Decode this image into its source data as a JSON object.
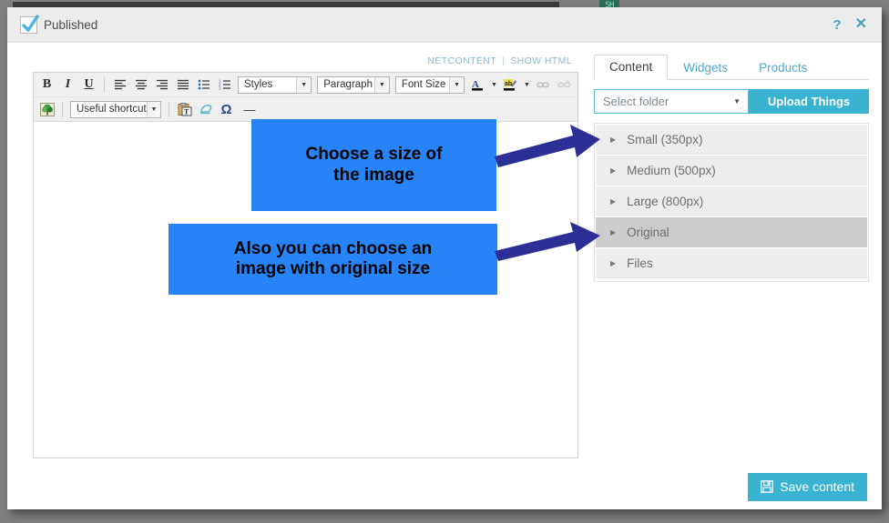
{
  "window": {
    "published_label": "Published",
    "help_icon": "question-mark-icon",
    "close_icon": "close-x-icon",
    "accent_color": "#39b3d0",
    "checkbox_checked": true
  },
  "background": {
    "tag_text": "SH"
  },
  "editor": {
    "links": {
      "netcontent": "NETCONTENT",
      "separator": "|",
      "show_html": "SHOW HTML"
    },
    "toolbar_row1": [
      {
        "name": "bold-button",
        "label": "B",
        "kind": "text-b"
      },
      {
        "name": "italic-button",
        "label": "I",
        "kind": "text-i"
      },
      {
        "name": "underline-button",
        "label": "U",
        "kind": "text-u"
      },
      {
        "name": "separator",
        "label": "",
        "kind": "sep"
      },
      {
        "name": "align-left-button",
        "label": "",
        "kind": "align-left"
      },
      {
        "name": "align-center-button",
        "label": "",
        "kind": "align-center"
      },
      {
        "name": "align-right-button",
        "label": "",
        "kind": "align-right"
      },
      {
        "name": "align-justify-button",
        "label": "",
        "kind": "align-justify"
      },
      {
        "name": "bulleted-list-button",
        "label": "",
        "kind": "ul"
      },
      {
        "name": "numbered-list-button",
        "label": "",
        "kind": "ol"
      }
    ],
    "selects_row1": [
      {
        "name": "styles-select",
        "value": "Styles"
      },
      {
        "name": "paragraph-select",
        "value": "Paragraph"
      },
      {
        "name": "font-size-select",
        "value": "Font Size"
      }
    ],
    "toolbar_row1_end": [
      {
        "name": "text-color-button",
        "label": "A"
      },
      {
        "name": "text-color-dropdown",
        "label": "▾"
      },
      {
        "name": "highlight-color-button",
        "label": "ab"
      },
      {
        "name": "highlight-color-dropdown",
        "label": "▾"
      },
      {
        "name": "insert-link-button",
        "label": ""
      },
      {
        "name": "unlink-button",
        "label": ""
      }
    ],
    "toolbar_row2": {
      "image-tree-button": "tree-image-icon",
      "shortcuts_select": "Useful shortcuts",
      "paste-text-button": "paste-as-text-icon",
      "erase-format-button": "eraser-icon",
      "special-char-button": "Ω",
      "horizontal-rule-button": "—"
    }
  },
  "panel": {
    "tabs": [
      {
        "label": "Content",
        "active": true
      },
      {
        "label": "Widgets",
        "active": false
      },
      {
        "label": "Products",
        "active": false
      }
    ],
    "folder_select_value": "Select folder",
    "upload_button": "Upload Things",
    "accordion_items": [
      {
        "label": "Small (350px)",
        "selected": false
      },
      {
        "label": "Medium (500px)",
        "selected": false
      },
      {
        "label": "Large (800px)",
        "selected": false
      },
      {
        "label": "Original",
        "selected": true
      },
      {
        "label": "Files",
        "selected": false
      }
    ]
  },
  "footer": {
    "save_label": "Save content",
    "save_icon": "floppy-disk-icon"
  },
  "annotations": [
    {
      "id": "anno1",
      "line1": "Choose a size of",
      "line2": "the image",
      "color": "#2684f7",
      "arrow_color": "#2c2f96",
      "points_to": "Small (350px)"
    },
    {
      "id": "anno2",
      "line1": "Also you can choose an",
      "line2": "image with original size",
      "color": "#2684f7",
      "arrow_color": "#2c2f96",
      "points_to": "Original"
    }
  ]
}
